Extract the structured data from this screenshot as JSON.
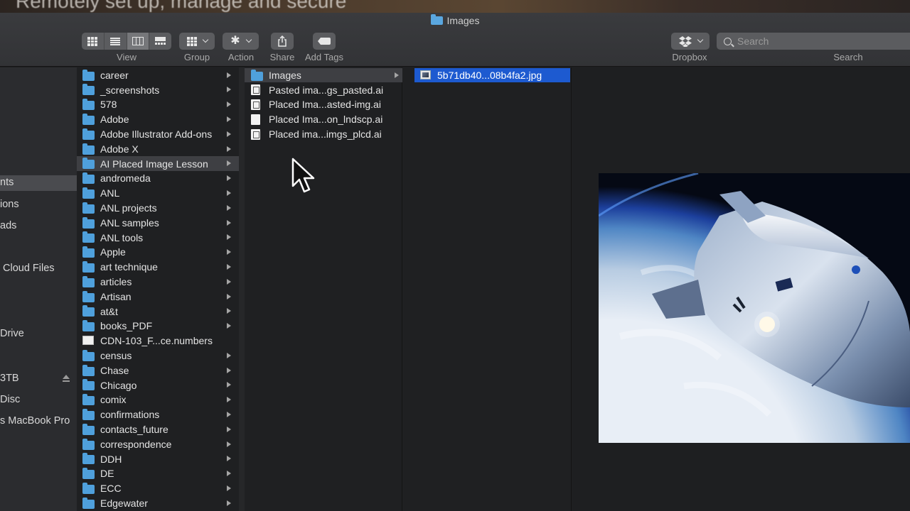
{
  "background": {
    "blurred_text": "Remotely set up, manage and secure"
  },
  "window": {
    "title": "Images"
  },
  "toolbar": {
    "view_label": "View",
    "group_label": "Group",
    "action_label": "Action",
    "share_label": "Share",
    "add_tags_label": "Add Tags",
    "dropbox_label": "Dropbox",
    "search_label": "Search",
    "search_placeholder": "Search",
    "active_view": "column"
  },
  "sidebar": {
    "items": [
      {
        "label": "nts",
        "selected": true
      },
      {
        "label": "ions"
      },
      {
        "label": "ads"
      },
      {
        "label": "Cloud Files"
      },
      {
        "label": "Drive"
      },
      {
        "label": "3TB"
      },
      {
        "label": "Disc"
      },
      {
        "label": "s MacBook Pro"
      }
    ]
  },
  "columns": {
    "col1": [
      {
        "label": "career",
        "type": "folder"
      },
      {
        "label": "_screenshots",
        "type": "folder"
      },
      {
        "label": "578",
        "type": "folder"
      },
      {
        "label": "Adobe",
        "type": "folder"
      },
      {
        "label": "Adobe Illustrator Add-ons",
        "type": "folder"
      },
      {
        "label": "Adobe X",
        "type": "folder"
      },
      {
        "label": "AI Placed Image Lesson",
        "type": "folder",
        "selected": true
      },
      {
        "label": "andromeda",
        "type": "folder"
      },
      {
        "label": "ANL",
        "type": "folder"
      },
      {
        "label": "ANL projects",
        "type": "folder"
      },
      {
        "label": "ANL samples",
        "type": "folder"
      },
      {
        "label": "ANL tools",
        "type": "folder"
      },
      {
        "label": "Apple",
        "type": "folder"
      },
      {
        "label": "art technique",
        "type": "folder"
      },
      {
        "label": "articles",
        "type": "folder"
      },
      {
        "label": "Artisan",
        "type": "folder"
      },
      {
        "label": "at&t",
        "type": "folder"
      },
      {
        "label": "books_PDF",
        "type": "folder"
      },
      {
        "label": "CDN-103_F...ce.numbers",
        "type": "file"
      },
      {
        "label": "census",
        "type": "folder"
      },
      {
        "label": "Chase",
        "type": "folder"
      },
      {
        "label": "Chicago",
        "type": "folder"
      },
      {
        "label": "comix",
        "type": "folder"
      },
      {
        "label": "confirmations",
        "type": "folder"
      },
      {
        "label": "contacts_future",
        "type": "folder"
      },
      {
        "label": "correspondence",
        "type": "folder"
      },
      {
        "label": "DDH",
        "type": "folder"
      },
      {
        "label": "DE",
        "type": "folder"
      },
      {
        "label": "ECC",
        "type": "folder"
      },
      {
        "label": "Edgewater",
        "type": "folder"
      }
    ],
    "col2": [
      {
        "label": "Images",
        "type": "folder",
        "selected": true
      },
      {
        "label": "Pasted ima...gs_pasted.ai",
        "type": "ai"
      },
      {
        "label": "Placed Ima...asted-img.ai",
        "type": "ai"
      },
      {
        "label": "Placed Ima...on_lndscp.ai",
        "type": "blank"
      },
      {
        "label": "Placed ima...imgs_plcd.ai",
        "type": "ai"
      }
    ],
    "col3": [
      {
        "label": "5b71db40...08b4fa2.jpg",
        "type": "image",
        "selected": true
      }
    ]
  },
  "preview": {
    "image_subject": "spacecraft-capsule-over-earth"
  },
  "colors": {
    "accent_blue": "#1d5ad0",
    "folder_blue": "#4fa0dc"
  }
}
